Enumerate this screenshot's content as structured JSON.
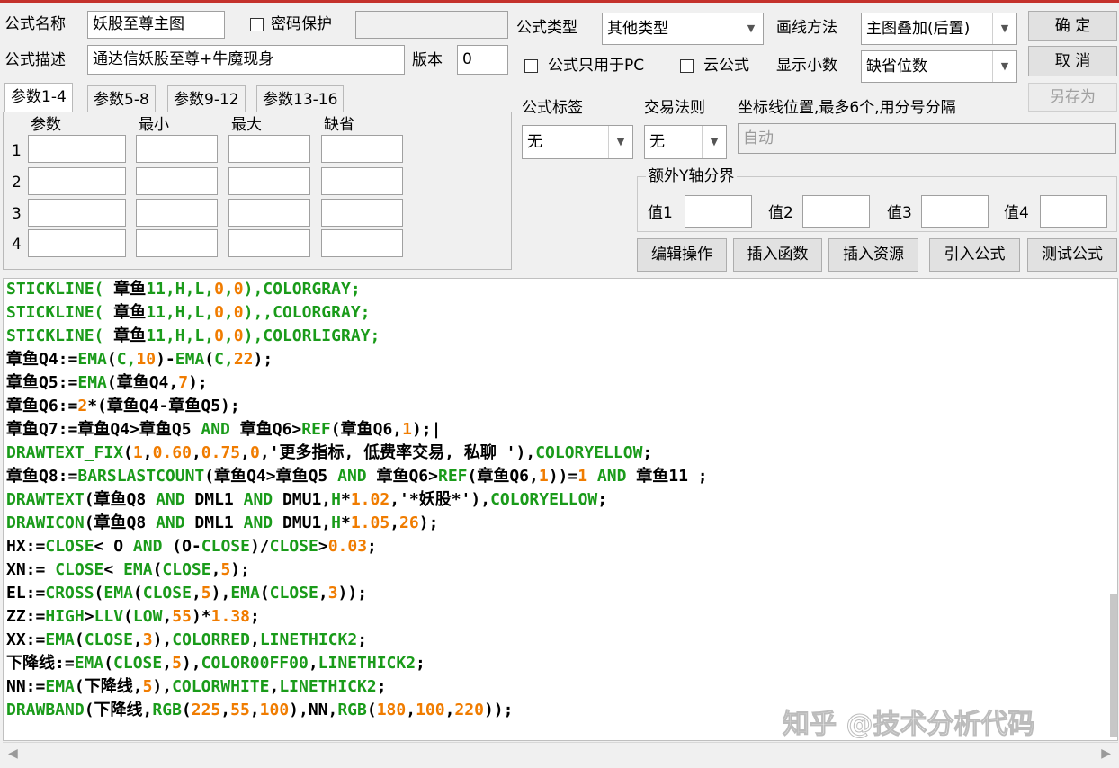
{
  "colors": {
    "window_border": "#c4322c",
    "code_green": "#1a9b1a",
    "code_orange": "#f07c00",
    "code_black": "#000000",
    "code_ident_green": "#1a9b1a"
  },
  "form": {
    "name_label": "公式名称",
    "name_value": "妖股至尊主图",
    "password_label": "密码保护",
    "desc_label": "公式描述",
    "desc_value": "通达信妖股至尊+牛魔现身",
    "version_label": "版本",
    "version_value": "0",
    "type_label": "公式类型",
    "type_value": "其他类型",
    "draw_label": "画线方法",
    "draw_value": "主图叠加(后置)",
    "pc_only_label": "公式只用于PC",
    "cloud_label": "云公式",
    "decimals_label": "显示小数",
    "decimals_value": "缺省位数",
    "tag_label": "公式标签",
    "tag_value": "无",
    "trade_rule_label": "交易法则",
    "trade_rule_value": "无",
    "axis_label": "坐标线位置,最多6个,用分号分隔",
    "axis_value": "自动",
    "extra_y_label": "额外Y轴分界",
    "extra_vals": [
      "值1",
      "值2",
      "值3",
      "值4"
    ]
  },
  "buttons": {
    "ok": "确  定",
    "cancel": "取  消",
    "save_as": "另存为",
    "edit": "编辑操作",
    "insert_func": "插入函数",
    "insert_res": "插入资源",
    "import": "引入公式",
    "test": "测试公式"
  },
  "tabs": [
    "参数1-4",
    "参数5-8",
    "参数9-12",
    "参数13-16"
  ],
  "param_headers": [
    "参数",
    "最小",
    "最大",
    "缺省"
  ],
  "param_rows": [
    "1",
    "2",
    "3",
    "4"
  ],
  "code": [
    [
      [
        "g",
        "STICKLINE( "
      ],
      [
        "k",
        "章鱼"
      ],
      [
        "g",
        "11,H,L,"
      ],
      [
        "o",
        "0"
      ],
      [
        "g",
        ","
      ],
      [
        "o",
        "0"
      ],
      [
        "g",
        "),COLORGRAY;"
      ]
    ],
    [
      [
        "g",
        "STICKLINE( "
      ],
      [
        "k",
        "章鱼"
      ],
      [
        "g",
        "11,H,L,"
      ],
      [
        "o",
        "0"
      ],
      [
        "g",
        ","
      ],
      [
        "o",
        "0"
      ],
      [
        "g",
        "),,COLORGRAY;"
      ]
    ],
    [
      [
        "g",
        "STICKLINE( "
      ],
      [
        "k",
        "章鱼"
      ],
      [
        "g",
        "11,H,L,"
      ],
      [
        "o",
        "0"
      ],
      [
        "g",
        ","
      ],
      [
        "o",
        "0"
      ],
      [
        "g",
        "),COLORLIGRAY;"
      ]
    ],
    [
      [
        "k",
        "章鱼Q4:="
      ],
      [
        "g",
        "EMA"
      ],
      [
        "k",
        "("
      ],
      [
        "g",
        "C,"
      ],
      [
        "o",
        "10"
      ],
      [
        "k",
        ")-"
      ],
      [
        "g",
        "EMA"
      ],
      [
        "k",
        "("
      ],
      [
        "g",
        "C,"
      ],
      [
        "o",
        "22"
      ],
      [
        "k",
        ");"
      ]
    ],
    [
      [
        "k",
        "章鱼Q5:="
      ],
      [
        "g",
        "EMA"
      ],
      [
        "k",
        "(章鱼Q4,"
      ],
      [
        "o",
        "7"
      ],
      [
        "k",
        ");"
      ]
    ],
    [
      [
        "k",
        "章鱼Q6:="
      ],
      [
        "o",
        "2"
      ],
      [
        "k",
        "*(章鱼Q4-章鱼Q5);"
      ]
    ],
    [
      [
        "k",
        "章鱼Q7:=章鱼Q4>章鱼Q5 "
      ],
      [
        "g",
        "AND"
      ],
      [
        "k",
        " 章鱼Q6>"
      ],
      [
        "g",
        "REF"
      ],
      [
        "k",
        "(章鱼Q6,"
      ],
      [
        "o",
        "1"
      ],
      [
        "k",
        ");|"
      ]
    ],
    [
      [
        "g",
        "DRAWTEXT_FIX"
      ],
      [
        "k",
        "("
      ],
      [
        "o",
        "1"
      ],
      [
        "k",
        ","
      ],
      [
        "o",
        "0.60"
      ],
      [
        "k",
        ","
      ],
      [
        "o",
        "0.75"
      ],
      [
        "k",
        ","
      ],
      [
        "o",
        "0"
      ],
      [
        "k",
        ",'更多指标, 低费率交易, 私聊 '),"
      ],
      [
        "g",
        "COLORYELLOW"
      ],
      [
        "k",
        ";"
      ]
    ],
    [
      [
        "k",
        "章鱼Q8:="
      ],
      [
        "g",
        "BARSLASTCOUNT"
      ],
      [
        "k",
        "(章鱼Q4>章鱼Q5 "
      ],
      [
        "g",
        "AND"
      ],
      [
        "k",
        " 章鱼Q6>"
      ],
      [
        "g",
        "REF"
      ],
      [
        "k",
        "(章鱼Q6,"
      ],
      [
        "o",
        "1"
      ],
      [
        "k",
        "))="
      ],
      [
        "o",
        "1"
      ],
      [
        "k",
        " "
      ],
      [
        "g",
        "AND"
      ],
      [
        "k",
        " 章鱼11 ;"
      ]
    ],
    [
      [
        "g",
        "DRAWTEXT"
      ],
      [
        "k",
        "(章鱼Q8 "
      ],
      [
        "g",
        "AND"
      ],
      [
        "k",
        " DML1 "
      ],
      [
        "g",
        "AND"
      ],
      [
        "k",
        " DMU1,"
      ],
      [
        "g",
        "H"
      ],
      [
        "k",
        "*"
      ],
      [
        "o",
        "1.02"
      ],
      [
        "k",
        ",'*妖股*'),"
      ],
      [
        "g",
        "COLORYELLOW"
      ],
      [
        "k",
        ";"
      ]
    ],
    [
      [
        "g",
        "DRAWICON"
      ],
      [
        "k",
        "(章鱼Q8 "
      ],
      [
        "g",
        "AND"
      ],
      [
        "k",
        " DML1 "
      ],
      [
        "g",
        "AND"
      ],
      [
        "k",
        " DMU1,"
      ],
      [
        "g",
        "H"
      ],
      [
        "k",
        "*"
      ],
      [
        "o",
        "1.05"
      ],
      [
        "k",
        ","
      ],
      [
        "o",
        "26"
      ],
      [
        "k",
        ");"
      ]
    ],
    [
      [
        "k",
        "HX:="
      ],
      [
        "g",
        "CLOSE"
      ],
      [
        "k",
        "< O "
      ],
      [
        "g",
        "AND"
      ],
      [
        "k",
        " (O-"
      ],
      [
        "g",
        "CLOSE"
      ],
      [
        "k",
        ")/"
      ],
      [
        "g",
        "CLOSE"
      ],
      [
        "k",
        ">"
      ],
      [
        "o",
        "0.03"
      ],
      [
        "k",
        ";"
      ]
    ],
    [
      [
        "k",
        "XN:= "
      ],
      [
        "g",
        "CLOSE"
      ],
      [
        "k",
        "< "
      ],
      [
        "g",
        "EMA"
      ],
      [
        "k",
        "("
      ],
      [
        "g",
        "CLOSE"
      ],
      [
        "k",
        ","
      ],
      [
        "o",
        "5"
      ],
      [
        "k",
        ");"
      ]
    ],
    [
      [
        "k",
        "EL:="
      ],
      [
        "g",
        "CROSS"
      ],
      [
        "k",
        "("
      ],
      [
        "g",
        "EMA"
      ],
      [
        "k",
        "("
      ],
      [
        "g",
        "CLOSE"
      ],
      [
        "k",
        ","
      ],
      [
        "o",
        "5"
      ],
      [
        "k",
        "),"
      ],
      [
        "g",
        "EMA"
      ],
      [
        "k",
        "("
      ],
      [
        "g",
        "CLOSE"
      ],
      [
        "k",
        ","
      ],
      [
        "o",
        "3"
      ],
      [
        "k",
        "));"
      ]
    ],
    [
      [
        "k",
        "ZZ:="
      ],
      [
        "g",
        "HIGH"
      ],
      [
        "k",
        ">"
      ],
      [
        "g",
        "LLV"
      ],
      [
        "k",
        "("
      ],
      [
        "g",
        "LOW"
      ],
      [
        "k",
        ","
      ],
      [
        "o",
        "55"
      ],
      [
        "k",
        ")*"
      ],
      [
        "o",
        "1.38"
      ],
      [
        "k",
        ";"
      ]
    ],
    [
      [
        "k",
        "XX:="
      ],
      [
        "g",
        "EMA"
      ],
      [
        "k",
        "("
      ],
      [
        "g",
        "CLOSE"
      ],
      [
        "k",
        ","
      ],
      [
        "o",
        "3"
      ],
      [
        "k",
        "),"
      ],
      [
        "g",
        "COLORRED"
      ],
      [
        "k",
        ","
      ],
      [
        "g",
        "LINETHICK2"
      ],
      [
        "k",
        ";"
      ]
    ],
    [
      [
        "k",
        "下降线:="
      ],
      [
        "g",
        "EMA"
      ],
      [
        "k",
        "("
      ],
      [
        "g",
        "CLOSE"
      ],
      [
        "k",
        ","
      ],
      [
        "o",
        "5"
      ],
      [
        "k",
        "),"
      ],
      [
        "g",
        "COLOR00FF00"
      ],
      [
        "k",
        ","
      ],
      [
        "g",
        "LINETHICK2"
      ],
      [
        "k",
        ";"
      ]
    ],
    [
      [
        "k",
        "NN:="
      ],
      [
        "g",
        "EMA"
      ],
      [
        "k",
        "(下降线,"
      ],
      [
        "o",
        "5"
      ],
      [
        "k",
        "),"
      ],
      [
        "g",
        "COLORWHITE"
      ],
      [
        "k",
        ","
      ],
      [
        "g",
        "LINETHICK2"
      ],
      [
        "k",
        ";"
      ]
    ],
    [
      [
        "g",
        "DRAWBAND"
      ],
      [
        "k",
        "(下降线,"
      ],
      [
        "g",
        "RGB"
      ],
      [
        "k",
        "("
      ],
      [
        "o",
        "225"
      ],
      [
        "k",
        ","
      ],
      [
        "o",
        "55"
      ],
      [
        "k",
        ","
      ],
      [
        "o",
        "100"
      ],
      [
        "k",
        "),NN,"
      ],
      [
        "g",
        "RGB"
      ],
      [
        "k",
        "("
      ],
      [
        "o",
        "180"
      ],
      [
        "k",
        ","
      ],
      [
        "o",
        "100"
      ],
      [
        "k",
        ","
      ],
      [
        "o",
        "220"
      ],
      [
        "k",
        "));"
      ]
    ]
  ],
  "watermark": "知乎 @技术分析代码"
}
